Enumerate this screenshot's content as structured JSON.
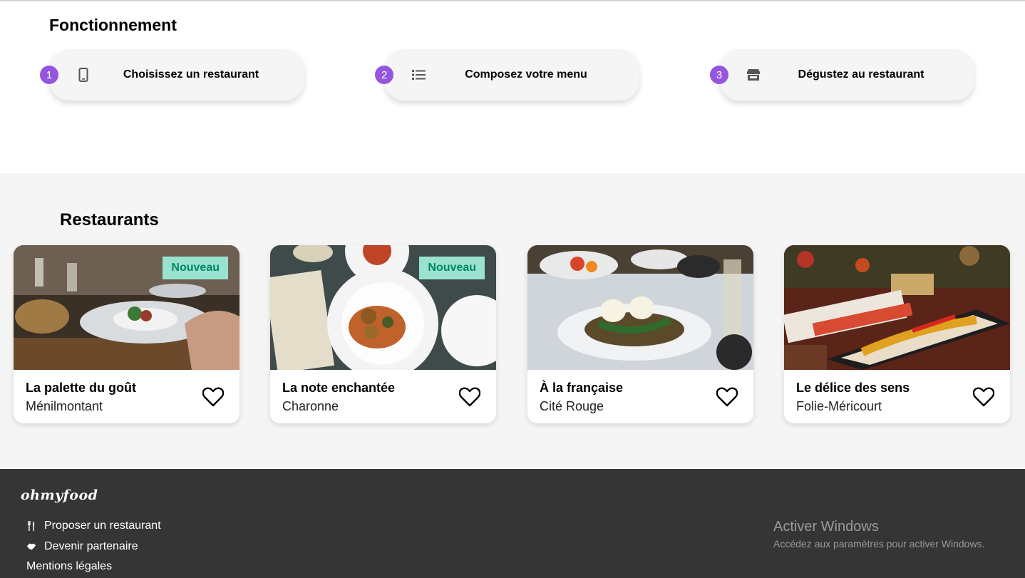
{
  "how": {
    "title": "Fonctionnement",
    "steps": [
      {
        "num": "1",
        "label": "Choisissez un restaurant",
        "icon": "phone-icon"
      },
      {
        "num": "2",
        "label": "Composez votre menu",
        "icon": "list-icon"
      },
      {
        "num": "3",
        "label": "Dégustez au restaurant",
        "icon": "store-icon"
      }
    ]
  },
  "restaurants": {
    "title": "Restaurants",
    "cards": [
      {
        "name": "La palette du goût",
        "location": "Ménilmontant",
        "badge": "Nouveau"
      },
      {
        "name": "La note enchantée",
        "location": "Charonne",
        "badge": "Nouveau"
      },
      {
        "name": "À la française",
        "location": "Cité Rouge",
        "badge": ""
      },
      {
        "name": "Le délice des sens",
        "location": "Folie-Méricourt",
        "badge": ""
      }
    ]
  },
  "footer": {
    "logo": "ohmyfood",
    "links": [
      {
        "label": "Proposer un restaurant",
        "icon": "utensils-icon"
      },
      {
        "label": "Devenir partenaire",
        "icon": "handshake-icon"
      },
      {
        "label": "Mentions légales",
        "icon": ""
      }
    ]
  },
  "windows_notice": {
    "title": "Activer Windows",
    "subtitle": "Accédez aux paramètres pour activer Windows."
  },
  "colors": {
    "accent": "#9356dc",
    "badge_bg": "#99e2d0",
    "badge_text": "#008766",
    "footer_bg": "#353535"
  }
}
